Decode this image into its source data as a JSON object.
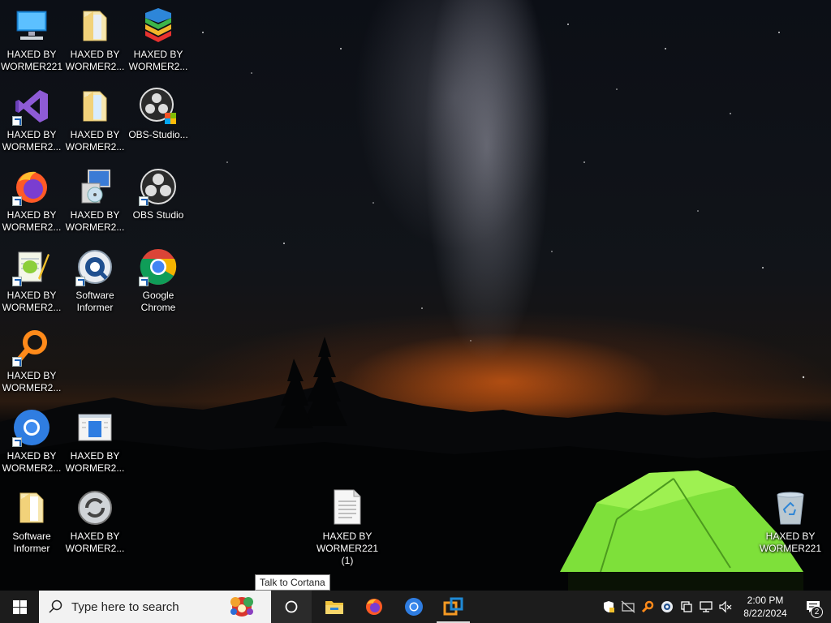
{
  "desktop": {
    "icons": [
      {
        "label": "HAXED BY\nWORMER221",
        "icon": "this-pc-icon"
      },
      {
        "label": "HAXED BY\nWORMER2...",
        "icon": "folder-icon"
      },
      {
        "label": "HAXED BY\nWORMER2...",
        "icon": "bluestacks-icon"
      },
      {
        "label": "HAXED BY\nWORMER2...",
        "icon": "visual-studio-icon"
      },
      {
        "label": "HAXED BY\nWORMER2...",
        "icon": "folder-icon"
      },
      {
        "label": "OBS-Studio...",
        "icon": "obs-installer-icon"
      },
      {
        "label": "HAXED BY\nWORMER2...",
        "icon": "firefox-icon"
      },
      {
        "label": "HAXED BY\nWORMER2...",
        "icon": "installer-icon"
      },
      {
        "label": "OBS Studio",
        "icon": "obs-icon"
      },
      {
        "label": "HAXED BY\nWORMER2...",
        "icon": "notepad-plus-plus-icon"
      },
      {
        "label": "Software\nInformer",
        "icon": "software-informer-icon"
      },
      {
        "label": "Google\nChrome",
        "icon": "chrome-icon"
      },
      {
        "label": "HAXED BY\nWORMER2...",
        "icon": "search-key-icon"
      },
      {
        "label": "HAXED BY\nWORMER2...",
        "icon": "chromium-icon"
      },
      {
        "label": "HAXED BY\nWORMER2...",
        "icon": "window-app-icon"
      },
      {
        "label": "Software\nInformer",
        "icon": "folder-icon"
      },
      {
        "label": "HAXED BY\nWORMER2...",
        "icon": "sync-app-icon"
      },
      {
        "label": "HAXED BY\nWORMER221\n(1)",
        "icon": "text-file-icon"
      },
      {
        "label": "HAXED BY\nWORMER221",
        "icon": "recycle-bin-icon"
      }
    ]
  },
  "tooltip": {
    "text": "Talk to Cortana"
  },
  "taskbar": {
    "search_placeholder": "Type here to search",
    "pinned": [
      "file-explorer-icon",
      "firefox-icon",
      "chromium-icon",
      "virtualbox-icon"
    ],
    "tray_icons": [
      "security-shield-icon",
      "hidden-network-icon",
      "search-key-icon",
      "software-informer-icon",
      "display-icon",
      "network-icon",
      "volume-muted-icon"
    ],
    "time": "2:00 PM",
    "date": "8/22/2024",
    "notification_count": "2"
  },
  "colors": {
    "taskbar": "#1c1c1c",
    "searchbox": "#f2f2f2",
    "tent_green": "#7ee03a",
    "glow_orange": "#ff6e14"
  }
}
